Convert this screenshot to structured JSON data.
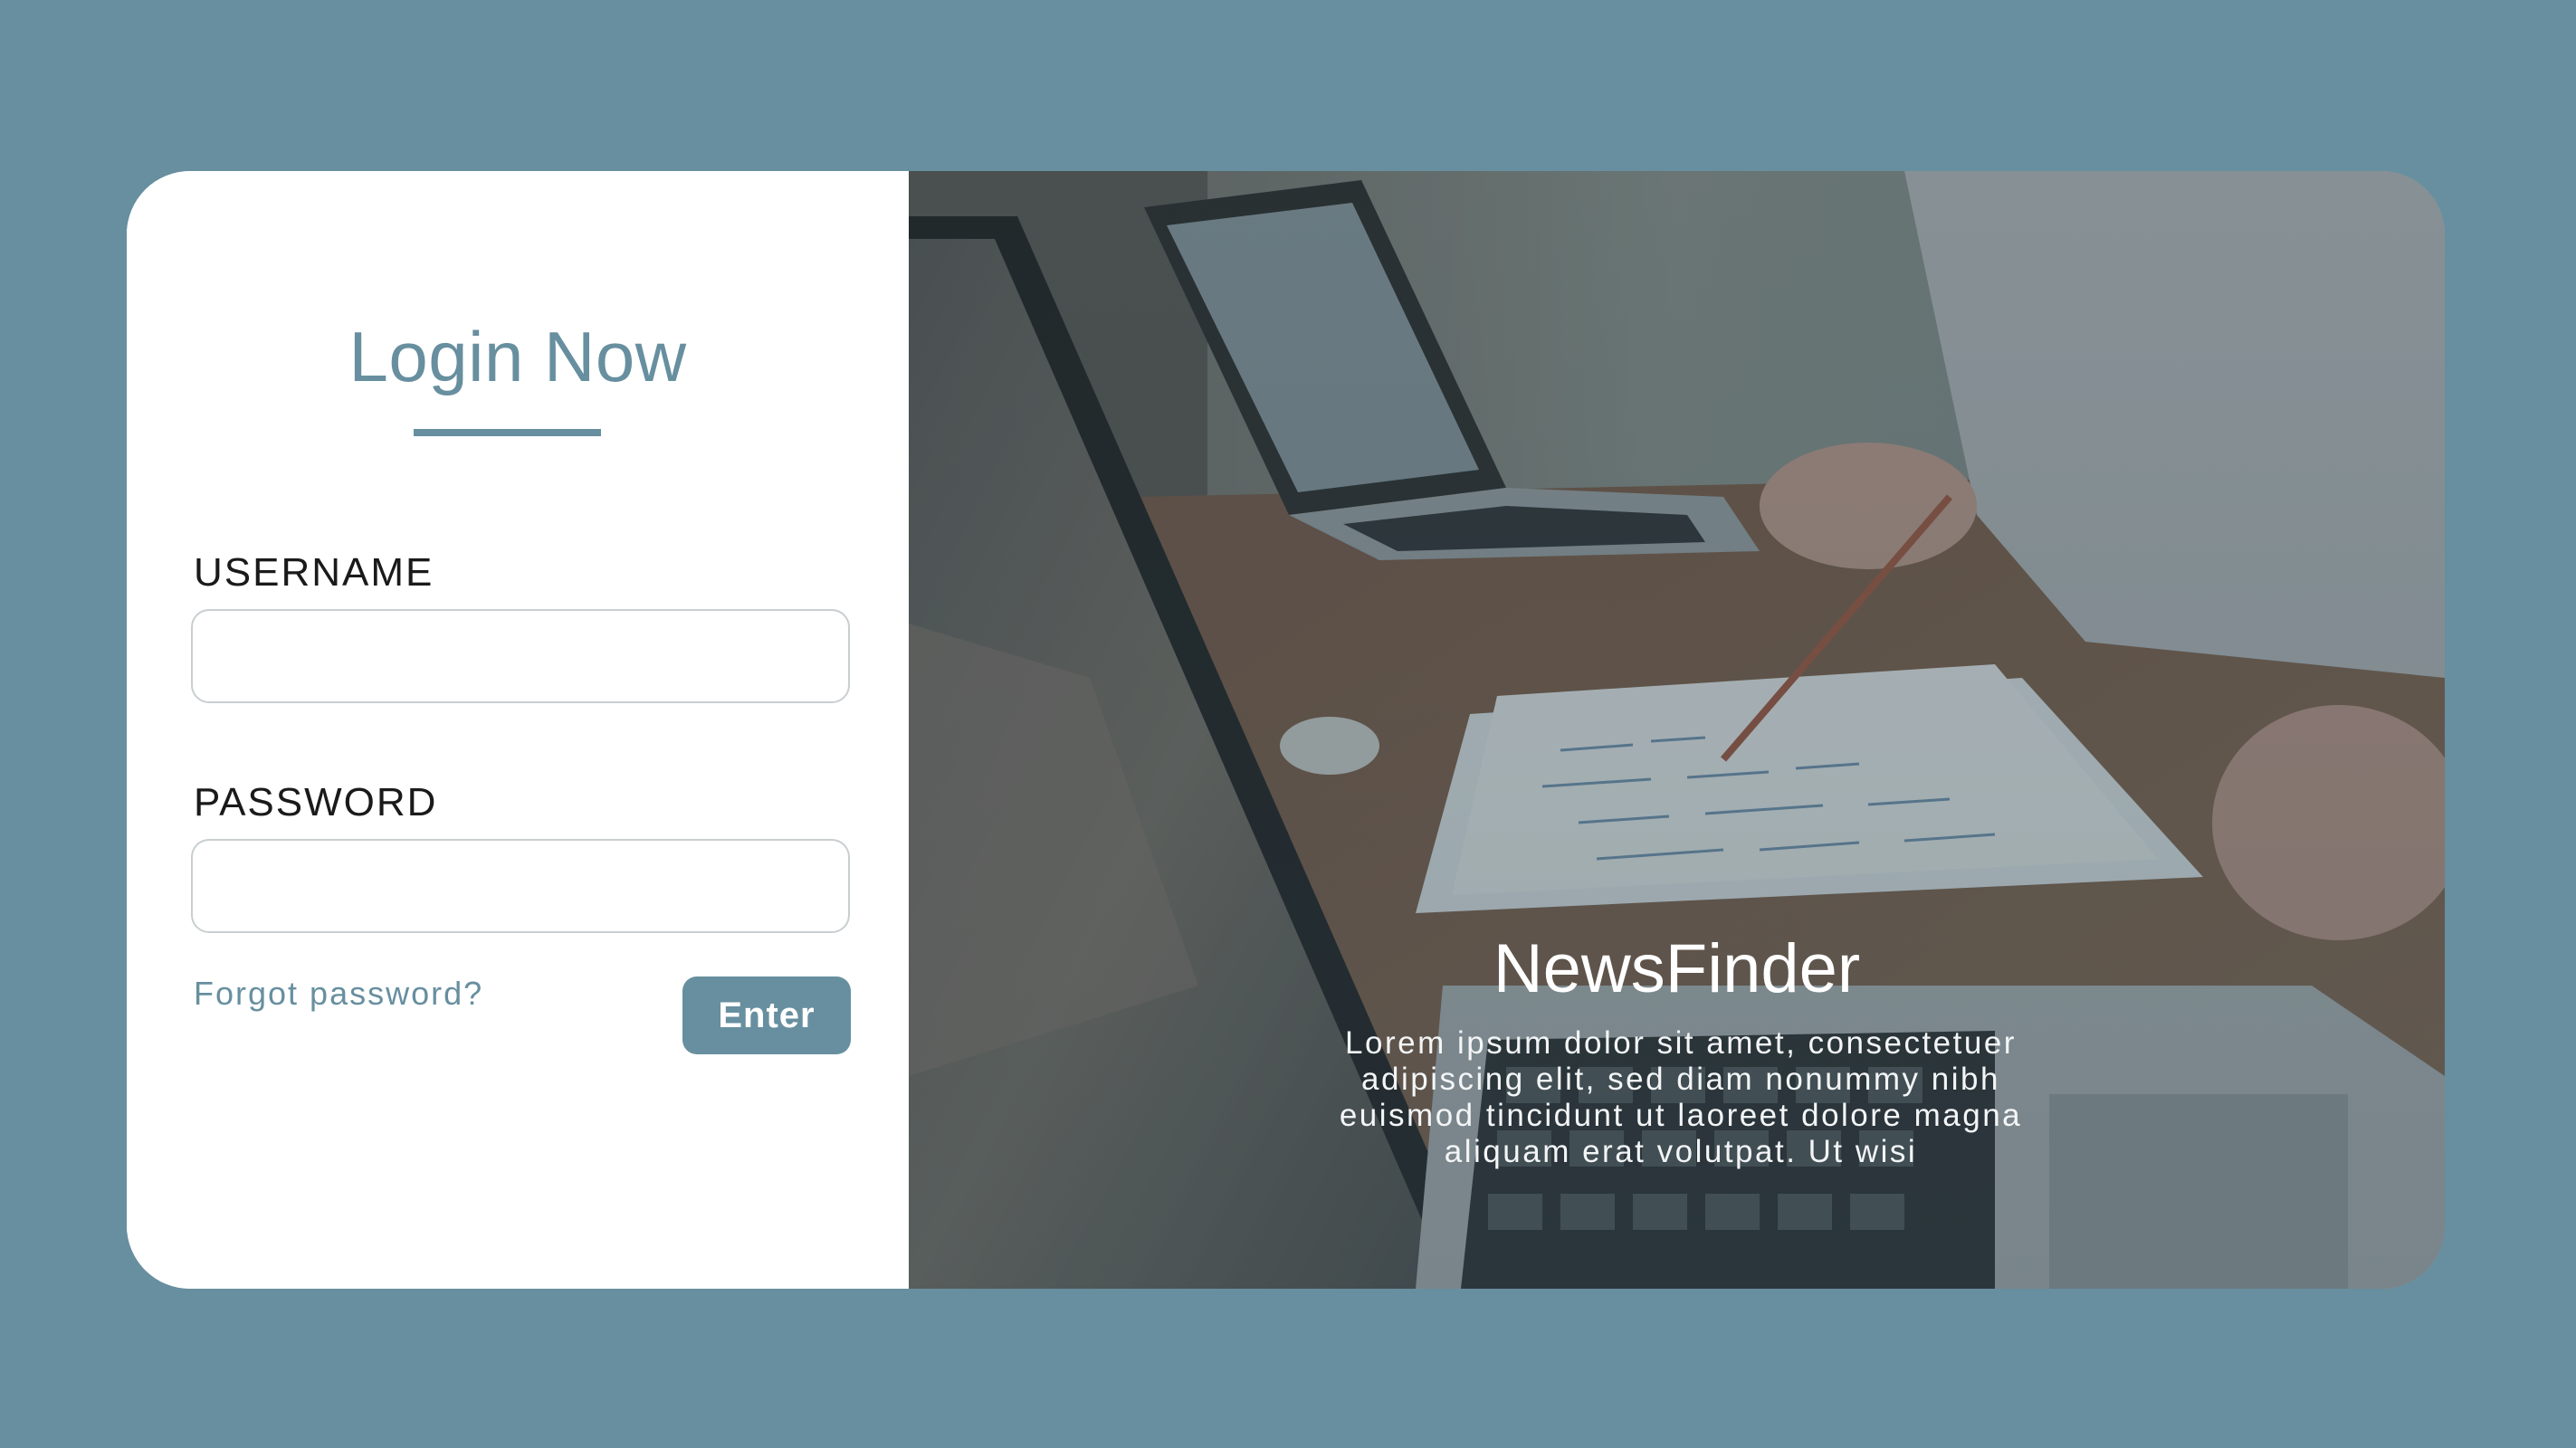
{
  "login": {
    "title": "Login Now",
    "username_label": "USERNAME",
    "username_value": "",
    "password_label": "PASSWORD",
    "password_value": "",
    "forgot_label": "Forgot password?",
    "enter_label": "Enter"
  },
  "brand": {
    "name": "NewsFinder",
    "description": "Lorem ipsum dolor sit amet, consectetuer adipiscing elit, sed diam nonummy nibh euismod tincidunt ut laoreet dolore magna aliquam erat volutpat. Ut wisi"
  },
  "colors": {
    "background": "#678f9f",
    "accent": "#678f9f",
    "panel": "#ffffff"
  },
  "icons": {
    "photo": "office-laptops-photo"
  }
}
